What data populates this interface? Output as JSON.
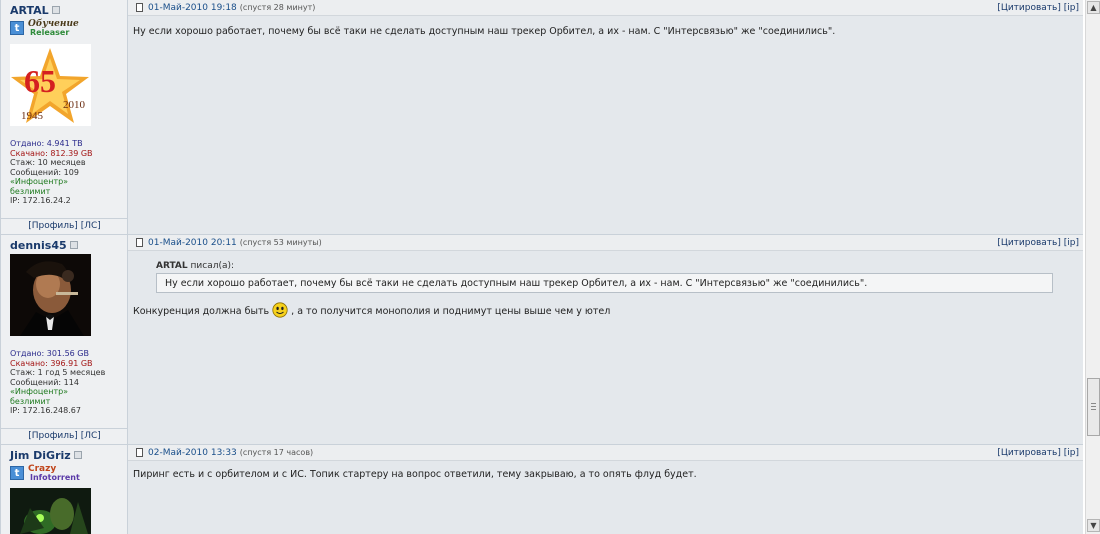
{
  "posts": [
    {
      "author": "ARTAL",
      "rank_line1": "Обучение",
      "rank_line2": "Releaser",
      "stats": {
        "uploaded": "Отдано: 4.941 TB",
        "downloaded": "Скачано: 812.39 GB",
        "experience": "Стаж: 10 месяцев",
        "messages": "Сообщений: 109",
        "provider": "«Инфоцентр»",
        "tariff": "безлимит",
        "ip": "IP: 172.16.24.2"
      },
      "avatar_text": {
        "year_start": "1945",
        "year_end": "2010",
        "number": "65"
      },
      "links": {
        "profile": "[Профиль]",
        "pm": "[ЛС]"
      },
      "date": "01-Май-2010 19:18",
      "ago": "(спустя 28 минут)",
      "actions": {
        "quote": "[Цитировать]",
        "ip": "[ip]"
      },
      "text": "Ну если хорошо работает, почему бы всё таки не сделать доступным наш трекер Орбител, а их - нам. С \"Интерсвязью\" же \"соединились\"."
    },
    {
      "author": "dennis45",
      "stats": {
        "uploaded": "Отдано: 301.56 GB",
        "downloaded": "Скачано: 396.91 GB",
        "experience": "Стаж: 1 год 5 месяцев",
        "messages": "Сообщений: 114",
        "provider": "«Инфоцентр»",
        "tariff": "безлимит",
        "ip": "IP: 172.16.248.67"
      },
      "links": {
        "profile": "[Профиль]",
        "pm": "[ЛС]"
      },
      "date": "01-Май-2010 20:11",
      "ago": "(спустя 53 минуты)",
      "actions": {
        "quote": "[Цитировать]",
        "ip": "[ip]"
      },
      "quote_author": "ARTAL",
      "quote_said": "писал(а):",
      "quote_text": "Ну если хорошо работает, почему бы всё таки не сделать доступным наш трекер Орбител, а их - нам. С \"Интерсвязью\" же \"соединились\".",
      "text_before": "Конкуренция должна быть",
      "text_after": ", а то получится монополия и поднимут цены выше чем у ютел"
    },
    {
      "author": "Jim DiGriz",
      "rank_line1": "Crazy",
      "rank_line2": "Infotorrent",
      "date": "02-Май-2010 13:33",
      "ago": "(спустя 17 часов)",
      "actions": {
        "quote": "[Цитировать]",
        "ip": "[ip]"
      },
      "text": "Пиринг есть и с орбителом и с ИС. Топик стартеру на вопрос ответили, тему закрываю, а то опять флуд будет."
    }
  ],
  "scrollbar": {
    "up": "▲",
    "down": "▼"
  },
  "icons": [
    "post-doc-icon",
    "online-status-icon",
    "smiley-icon",
    "rank-t-icon"
  ]
}
